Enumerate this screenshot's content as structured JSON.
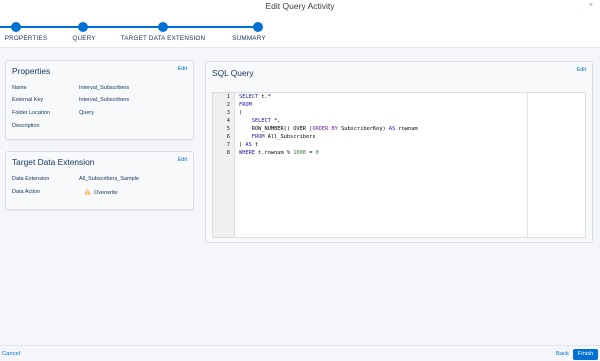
{
  "header": {
    "title": "Edit Query Activity",
    "close_glyph": "×"
  },
  "steps": [
    {
      "label": "PROPERTIES"
    },
    {
      "label": "QUERY"
    },
    {
      "label": "TARGET DATA EXTENSION"
    },
    {
      "label": "SUMMARY"
    }
  ],
  "properties": {
    "title": "Properties",
    "edit": "Edit",
    "fields": [
      {
        "label": "Name",
        "value": "Interval_Subscribers"
      },
      {
        "label": "External Key",
        "value": "Interval_Subscribers"
      },
      {
        "label": "Folder Location",
        "value": "Query"
      },
      {
        "label": "Description",
        "value": ""
      }
    ]
  },
  "target": {
    "title": "Target Data Extension",
    "edit": "Edit",
    "fields": [
      {
        "label": "Data Extension",
        "value": "All_Subscribers_Sample"
      },
      {
        "label": "Data Action",
        "value": "Overwrite"
      }
    ]
  },
  "sql": {
    "title": "SQL Query",
    "edit": "Edit",
    "line_numbers": [
      "1",
      "2",
      "3",
      "4",
      "5",
      "6",
      "7",
      "8"
    ]
  },
  "footer": {
    "cancel": "Cancel",
    "back": "Back",
    "finish": "Finish"
  },
  "colors": {
    "accent": "#0070d2",
    "warning": "#ffb75d"
  }
}
